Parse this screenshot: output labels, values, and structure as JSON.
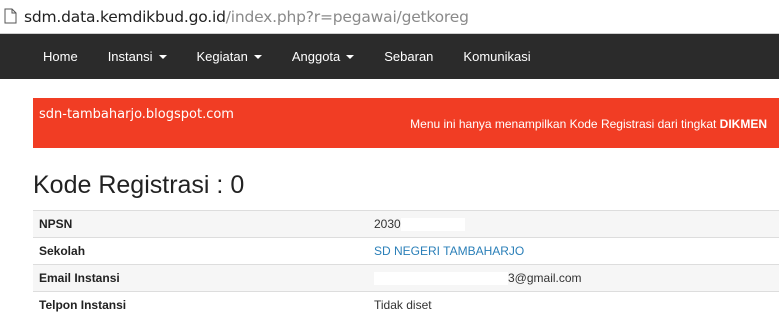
{
  "browser": {
    "url_host": "sdm.data.kemdikbud.go.id",
    "url_path": "/index.php?r=pegawai/getkoreg"
  },
  "navbar": {
    "items": [
      {
        "label": "Home",
        "dropdown": false
      },
      {
        "label": "Instansi",
        "dropdown": true
      },
      {
        "label": "Kegiatan",
        "dropdown": true
      },
      {
        "label": "Anggota",
        "dropdown": true
      },
      {
        "label": "Sebaran",
        "dropdown": false
      },
      {
        "label": "Komunikasi",
        "dropdown": false
      }
    ]
  },
  "alert": {
    "watermark": "sdn-tambaharjo.blogspot.com",
    "message_prefix": "Menu ini hanya menampilkan Kode Registrasi dari tingkat ",
    "message_bold": "DIKMEN",
    "color": "#f13d24"
  },
  "page": {
    "title": "Kode Registrasi : 0"
  },
  "info_table": {
    "rows": [
      {
        "label": "NPSN",
        "value": "2030"
      },
      {
        "label": "Sekolah",
        "value": "SD NEGERI TAMBAHARJO"
      },
      {
        "label": "Email Instansi",
        "value": "3@gmail.com"
      },
      {
        "label": "Telpon Instansi",
        "value": "Tidak diset"
      }
    ]
  },
  "colors": {
    "navbar_bg": "#2b2b2b",
    "link": "#2a7fb8"
  }
}
